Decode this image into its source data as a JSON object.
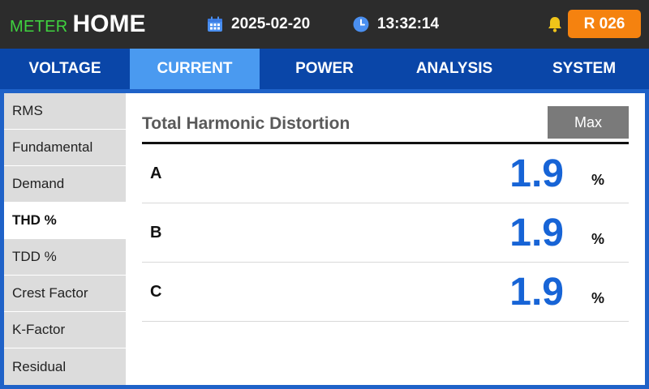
{
  "header": {
    "brand_prefix": "METER",
    "brand_title": "HOME",
    "date": "2025-02-20",
    "time": "13:32:14",
    "badge": "R 026",
    "icons": {
      "date": "calendar-icon",
      "time": "clock-icon",
      "alert": "bell-icon"
    },
    "colors": {
      "brand_prefix": "#3fd23f",
      "badge": "#f5820f",
      "bell": "#f0c419"
    }
  },
  "tabs": [
    {
      "label": "VOLTAGE",
      "active": false
    },
    {
      "label": "CURRENT",
      "active": true
    },
    {
      "label": "POWER",
      "active": false
    },
    {
      "label": "ANALYSIS",
      "active": false
    },
    {
      "label": "SYSTEM",
      "active": false
    }
  ],
  "sidebar": {
    "items": [
      {
        "label": "RMS",
        "active": false
      },
      {
        "label": "Fundamental",
        "active": false
      },
      {
        "label": "Demand",
        "active": false
      },
      {
        "label": "THD %",
        "active": true
      },
      {
        "label": "TDD %",
        "active": false
      },
      {
        "label": "Crest Factor",
        "active": false
      },
      {
        "label": "K-Factor",
        "active": false
      },
      {
        "label": "Residual",
        "active": false
      }
    ]
  },
  "panel": {
    "title": "Total Harmonic Distortion",
    "max_button": "Max",
    "rows": [
      {
        "label": "A",
        "value": "1.9",
        "unit": "%"
      },
      {
        "label": "B",
        "value": "1.9",
        "unit": "%"
      },
      {
        "label": "C",
        "value": "1.9",
        "unit": "%"
      }
    ]
  },
  "theme": {
    "active_tab": "#4a9af0",
    "tab_bar": "#0a46a8",
    "value_color": "#1764d6"
  }
}
